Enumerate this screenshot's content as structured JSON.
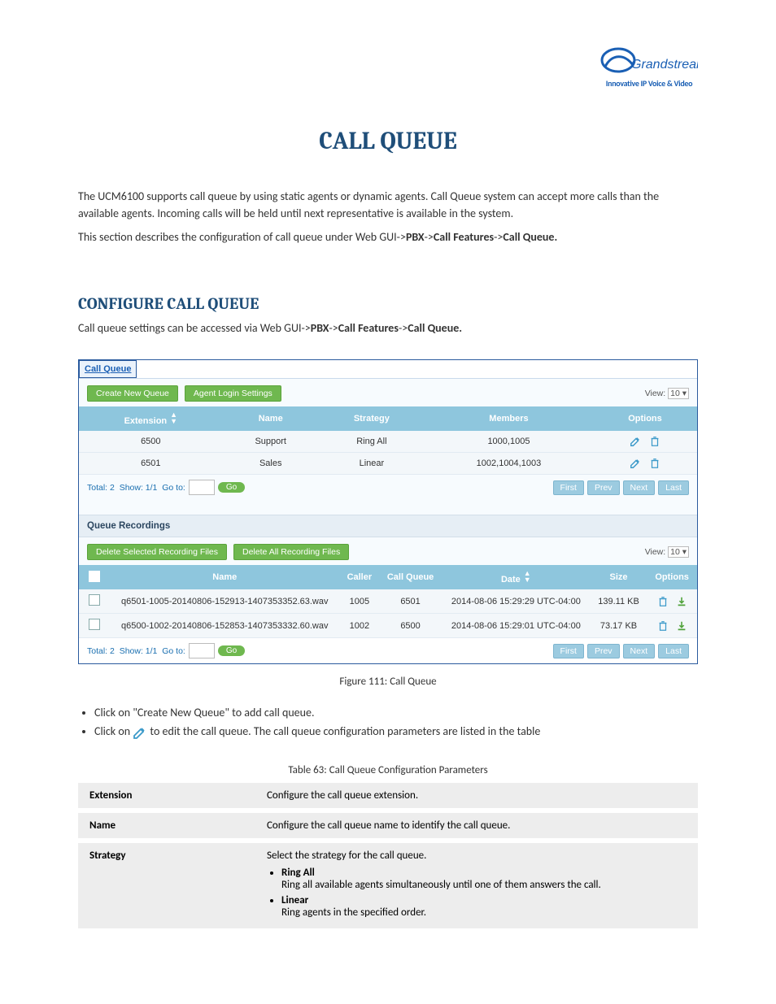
{
  "logo": {
    "brand": "Grandstream",
    "tagline": "Innovative IP Voice & Video"
  },
  "title": "CALL QUEUE",
  "intro1": "The UCM6100 supports call queue by using static agents or dynamic agents. Call Queue system can accept more calls than the available agents. Incoming calls will be held until next representative is available in the system.",
  "intro2": "This section describes the configuration of call queue under Web GUI->",
  "intro2b": "PBX",
  "intro2c": "->",
  "intro2d": "Call Features",
  "intro2e": "->",
  "intro2f": "Call Queue.",
  "section": "CONFIGURE CALL QUEUE",
  "configLine": "Call queue settings can be accessed via Web GUI->",
  "configLineB": "PBX",
  "configLineC": "->",
  "configLineD": "Call Features",
  "configLineE": "->",
  "configLineF": "Call Queue.",
  "figure": {
    "header": "Call Queue",
    "btnCreate": "Create New Queue",
    "btnAgent": "Agent Login Settings",
    "viewLabel": "View:",
    "viewValue": "10",
    "queueCols": [
      "Extension",
      "Name",
      "Strategy",
      "Members",
      "Options"
    ],
    "queueRows": [
      {
        "ext": "6500",
        "name": "Support",
        "strategy": "Ring All",
        "members": "1000,1005"
      },
      {
        "ext": "6501",
        "name": "Sales",
        "strategy": "Linear",
        "members": "1002,1004,1003"
      }
    ],
    "totalA": "Total: 2",
    "showA": "Show: 1/1",
    "gotoA": "Go to:",
    "goBtn": "Go",
    "pager": [
      "First",
      "Prev",
      "Next",
      "Last"
    ],
    "recHeader": "Queue Recordings",
    "btnDelSel": "Delete Selected Recording Files",
    "btnDelAll": "Delete All Recording Files",
    "recCols": [
      "Name",
      "Caller",
      "Call Queue",
      "Date",
      "Size",
      "Options"
    ],
    "recRows": [
      {
        "chk": false,
        "name": "q6501-1005-20140806-152913-1407353352.63.wav",
        "caller": "1005",
        "cq": "6501",
        "date": "2014-08-06 15:29:29 UTC-04:00",
        "size": "139.11 KB"
      },
      {
        "chk": false,
        "name": "q6500-1002-20140806-152853-1407353332.60.wav",
        "caller": "1002",
        "cq": "6500",
        "date": "2014-08-06 15:29:01 UTC-04:00",
        "size": "73.17 KB"
      }
    ],
    "caption": "Figure 111: Call Queue"
  },
  "bullets": {
    "create": "Click on \"Create New Queue\" to add call queue.",
    "editA": "Click on ",
    "editB": " to edit the call queue. The call queue configuration parameters are listed in the table"
  },
  "tableCaption": "Table 63: Call Queue Configuration Parameters",
  "params": [
    {
      "k": "Extension",
      "v": "Configure the call queue extension."
    },
    {
      "k": "Name",
      "v": "Configure the call queue name to identify the call queue."
    },
    {
      "k": "Strategy",
      "v": "Select the strategy for the call queue.",
      "items": [
        {
          "h": "Ring All",
          "t": "Ring all available agents simultaneously until one of them answers the call."
        },
        {
          "h": "Linear",
          "t": "Ring agents in the specified order."
        }
      ]
    }
  ]
}
